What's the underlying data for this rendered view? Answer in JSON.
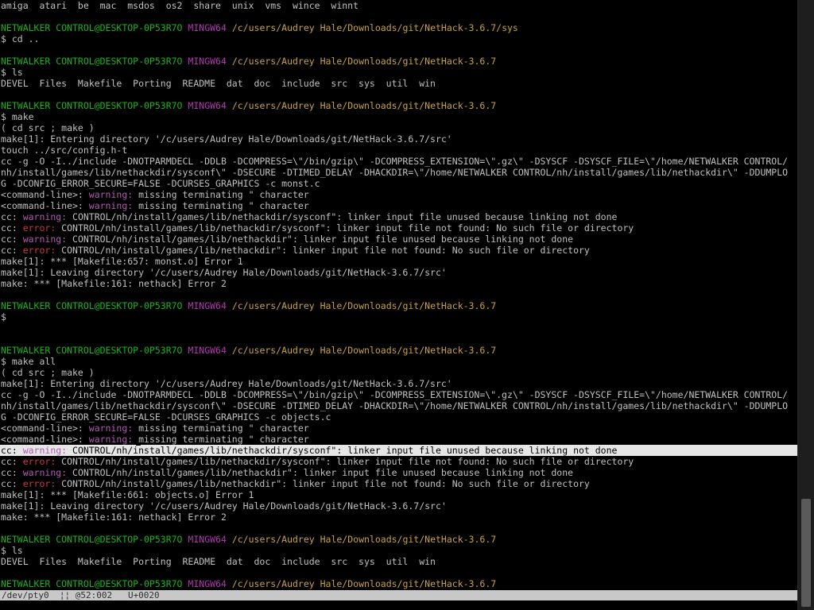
{
  "terminal": {
    "lines": [
      {
        "kind": "plain",
        "text": "amiga  atari  be  mac  msdos  os2  share  unix  vms  wince  winnt"
      },
      {
        "kind": "blank"
      },
      {
        "kind": "prompt",
        "user": "NETWALKER CONTROL@DESKTOP-0P53R7O",
        "env": "MINGW64",
        "path": "/c/users/Audrey Hale/Downloads/git/NetHack-3.6.7/sys"
      },
      {
        "kind": "plain",
        "text": "$ cd .."
      },
      {
        "kind": "blank"
      },
      {
        "kind": "prompt",
        "user": "NETWALKER CONTROL@DESKTOP-0P53R7O",
        "env": "MINGW64",
        "path": "/c/users/Audrey Hale/Downloads/git/NetHack-3.6.7"
      },
      {
        "kind": "plain",
        "text": "$ ls"
      },
      {
        "kind": "plain",
        "text": "DEVEL  Files  Makefile  Porting  README  dat  doc  include  src  sys  util  win"
      },
      {
        "kind": "blank"
      },
      {
        "kind": "prompt",
        "user": "NETWALKER CONTROL@DESKTOP-0P53R7O",
        "env": "MINGW64",
        "path": "/c/users/Audrey Hale/Downloads/git/NetHack-3.6.7"
      },
      {
        "kind": "plain",
        "text": "$ make"
      },
      {
        "kind": "plain",
        "text": "( cd src ; make )"
      },
      {
        "kind": "plain",
        "text": "make[1]: Entering directory '/c/users/Audrey Hale/Downloads/git/NetHack-3.6.7/src'"
      },
      {
        "kind": "plain",
        "text": "touch ../src/config.h-t"
      },
      {
        "kind": "plain",
        "text": "cc -g -O -I../include -DNOTPARMDECL -DDLB -DCOMPRESS=\\\"/bin/gzip\\\" -DCOMPRESS_EXTENSION=\\\".gz\\\" -DSYSCF -DSYSCF_FILE=\\\"/home/NETWALKER CONTROL/"
      },
      {
        "kind": "plain",
        "text": "nh/install/games/lib/nethackdir/sysconf\\\" -DSECURE -DTIMED_DELAY -DHACKDIR=\\\"/home/NETWALKER CONTROL/nh/install/games/lib/nethackdir\\\" -DDUMPLO"
      },
      {
        "kind": "plain",
        "text": "G -DCONFIG_ERROR_SECURE=FALSE -DCURSES_GRAPHICS -c monst.c"
      },
      {
        "kind": "diag",
        "prefix": "<command-line>: ",
        "level": "warn",
        "label": "warning:",
        "msg": " missing terminating \" character"
      },
      {
        "kind": "diag",
        "prefix": "<command-line>: ",
        "level": "warn",
        "label": "warning:",
        "msg": " missing terminating \" character"
      },
      {
        "kind": "diag",
        "prefix": "cc: ",
        "level": "warn",
        "label": "warning:",
        "msg": " CONTROL/nh/install/games/lib/nethackdir/sysconf\": linker input file unused because linking not done"
      },
      {
        "kind": "diag",
        "prefix": "cc: ",
        "level": "err",
        "label": "error:",
        "msg": " CONTROL/nh/install/games/lib/nethackdir/sysconf\": linker input file not found: No such file or directory"
      },
      {
        "kind": "diag",
        "prefix": "cc: ",
        "level": "warn",
        "label": "warning:",
        "msg": " CONTROL/nh/install/games/lib/nethackdir\": linker input file unused because linking not done"
      },
      {
        "kind": "diag",
        "prefix": "cc: ",
        "level": "err",
        "label": "error:",
        "msg": " CONTROL/nh/install/games/lib/nethackdir\": linker input file not found: No such file or directory"
      },
      {
        "kind": "plain",
        "text": "make[1]: *** [Makefile:657: monst.o] Error 1"
      },
      {
        "kind": "plain",
        "text": "make[1]: Leaving directory '/c/users/Audrey Hale/Downloads/git/NetHack-3.6.7/src'"
      },
      {
        "kind": "plain",
        "text": "make: *** [Makefile:161: nethack] Error 2"
      },
      {
        "kind": "blank"
      },
      {
        "kind": "prompt",
        "user": "NETWALKER CONTROL@DESKTOP-0P53R7O",
        "env": "MINGW64",
        "path": "/c/users/Audrey Hale/Downloads/git/NetHack-3.6.7"
      },
      {
        "kind": "plain",
        "text": "$"
      },
      {
        "kind": "blank"
      },
      {
        "kind": "blank"
      },
      {
        "kind": "prompt",
        "user": "NETWALKER CONTROL@DESKTOP-0P53R7O",
        "env": "MINGW64",
        "path": "/c/users/Audrey Hale/Downloads/git/NetHack-3.6.7"
      },
      {
        "kind": "plain",
        "text": "$ make all"
      },
      {
        "kind": "plain",
        "text": "( cd src ; make )"
      },
      {
        "kind": "plain",
        "text": "make[1]: Entering directory '/c/users/Audrey Hale/Downloads/git/NetHack-3.6.7/src'"
      },
      {
        "kind": "plain",
        "text": "cc -g -O -I../include -DNOTPARMDECL -DDLB -DCOMPRESS=\\\"/bin/gzip\\\" -DCOMPRESS_EXTENSION=\\\".gz\\\" -DSYSCF -DSYSCF_FILE=\\\"/home/NETWALKER CONTROL/"
      },
      {
        "kind": "plain",
        "text": "nh/install/games/lib/nethackdir/sysconf\\\" -DSECURE -DTIMED_DELAY -DHACKDIR=\\\"/home/NETWALKER CONTROL/nh/install/games/lib/nethackdir\\\" -DDUMPLO"
      },
      {
        "kind": "plain",
        "text": "G -DCONFIG_ERROR_SECURE=FALSE -DCURSES_GRAPHICS -c objects.c"
      },
      {
        "kind": "diag",
        "prefix": "<command-line>: ",
        "level": "warn",
        "label": "warning:",
        "msg": " missing terminating \" character"
      },
      {
        "kind": "diag",
        "prefix": "<command-line>: ",
        "level": "warn",
        "label": "warning:",
        "msg": " missing terminating \" character"
      },
      {
        "kind": "diag",
        "prefix": "cc: ",
        "level": "warn",
        "label": "warning:",
        "msg": " CONTROL/nh/install/games/lib/nethackdir/sysconf\": linker input file unused because linking not done",
        "selected": true
      },
      {
        "kind": "diag",
        "prefix": "cc: ",
        "level": "err",
        "label": "error:",
        "msg": " CONTROL/nh/install/games/lib/nethackdir/sysconf\": linker input file not found: No such file or directory"
      },
      {
        "kind": "diag",
        "prefix": "cc: ",
        "level": "warn",
        "label": "warning:",
        "msg": " CONTROL/nh/install/games/lib/nethackdir\": linker input file unused because linking not done"
      },
      {
        "kind": "diag",
        "prefix": "cc: ",
        "level": "err",
        "label": "error:",
        "msg": " CONTROL/nh/install/games/lib/nethackdir\": linker input file not found: No such file or directory"
      },
      {
        "kind": "plain",
        "text": "make[1]: *** [Makefile:661: objects.o] Error 1"
      },
      {
        "kind": "plain",
        "text": "make[1]: Leaving directory '/c/users/Audrey Hale/Downloads/git/NetHack-3.6.7/src'"
      },
      {
        "kind": "plain",
        "text": "make: *** [Makefile:161: nethack] Error 2"
      },
      {
        "kind": "blank"
      },
      {
        "kind": "prompt",
        "user": "NETWALKER CONTROL@DESKTOP-0P53R7O",
        "env": "MINGW64",
        "path": "/c/users/Audrey Hale/Downloads/git/NetHack-3.6.7"
      },
      {
        "kind": "plain",
        "text": "$ ls"
      },
      {
        "kind": "plain",
        "text": "DEVEL  Files  Makefile  Porting  README  dat  doc  include  src  sys  util  win"
      },
      {
        "kind": "blank"
      },
      {
        "kind": "prompt",
        "user": "NETWALKER CONTROL@DESKTOP-0P53R7O",
        "env": "MINGW64",
        "path": "/c/users/Audrey Hale/Downloads/git/NetHack-3.6.7"
      },
      {
        "kind": "input",
        "text": "$"
      }
    ]
  },
  "statusbar": {
    "text": "/dev/pty0  ¦¦ @52:002   U+0020"
  },
  "colors": {
    "background": "#000000",
    "text": "#c0c0c0",
    "prompt_user": "#1ab31a",
    "prompt_env": "#b038b0",
    "prompt_path": "#c8a23a",
    "warning": "#b05ab0",
    "error": "#c93a3a",
    "cursor": "#e6661a",
    "selection": "#e6e6e6"
  }
}
